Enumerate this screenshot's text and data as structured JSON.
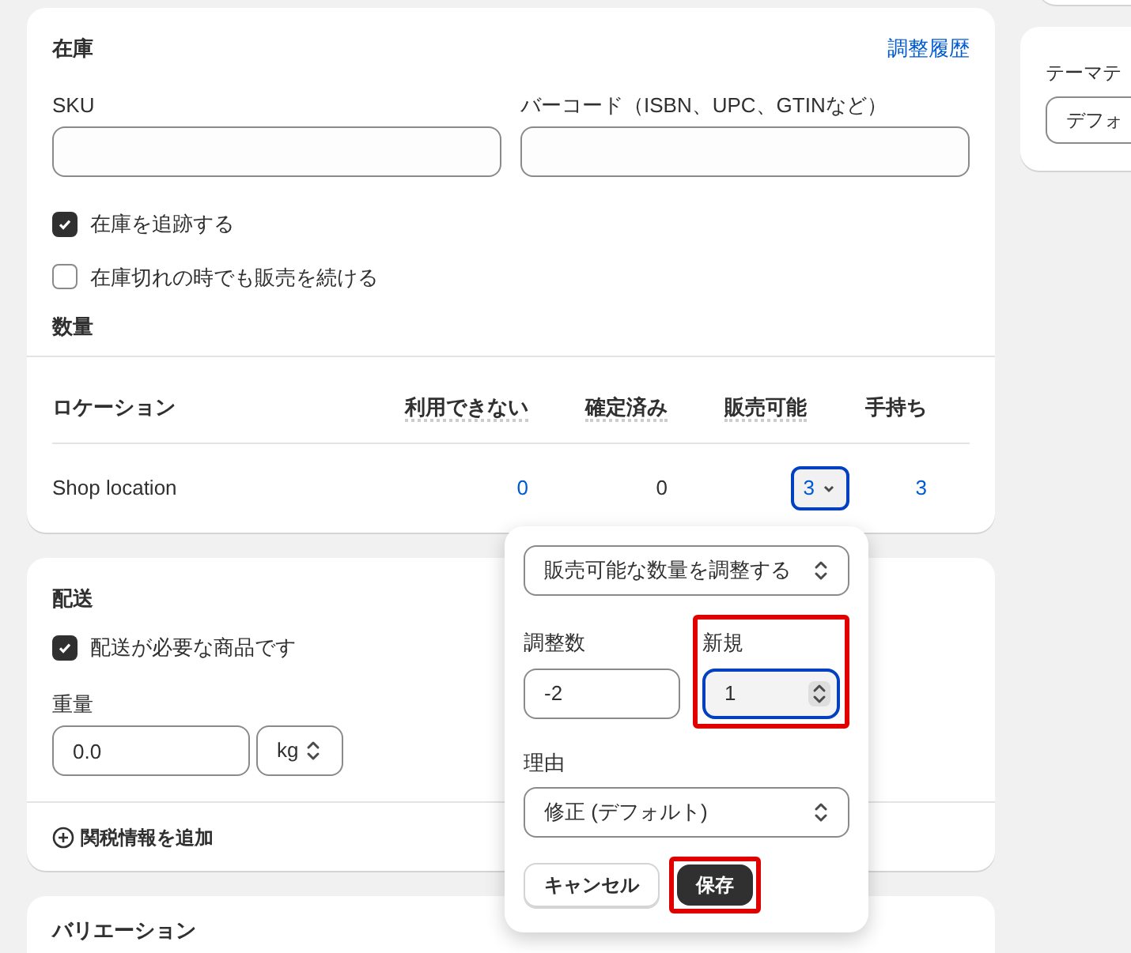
{
  "inventory": {
    "title": "在庫",
    "history_link": "調整履歴",
    "sku_label": "SKU",
    "barcode_label": "バーコード（ISBN、UPC、GTINなど）",
    "checkboxes": [
      {
        "label": "在庫を追跡する",
        "checked": true
      },
      {
        "label": "在庫切れの時でも販売を続ける",
        "checked": false
      }
    ],
    "quantity_title": "数量",
    "table": {
      "columns": [
        {
          "label": "ロケーション",
          "dotted": false
        },
        {
          "label": "利用できない",
          "dotted": true
        },
        {
          "label": "確定済み",
          "dotted": true
        },
        {
          "label": "販売可能",
          "dotted": true
        },
        {
          "label": "手持ち",
          "dotted": false
        }
      ],
      "rows": [
        {
          "cells": [
            {
              "kind": "location",
              "text": "Shop location"
            },
            {
              "kind": "link",
              "text": "0"
            },
            {
              "kind": "text",
              "text": "0"
            },
            {
              "kind": "dropdown",
              "text": "3",
              "expanded": true
            },
            {
              "kind": "link",
              "text": "3"
            }
          ]
        }
      ]
    }
  },
  "popover": {
    "adjust_select": "販売可能な数量を調整する",
    "adjust_label": "調整数",
    "adjust_value": "-2",
    "new_label": "新規",
    "new_value": "1",
    "new_highlighted": true,
    "reason_label": "理由",
    "reason_value": "修正 (デフォルト)",
    "cancel": "キャンセル",
    "save": "保存",
    "save_highlighted": true
  },
  "shipping": {
    "title": "配送",
    "checkbox": {
      "label": "配送が必要な商品です",
      "checked": true
    },
    "weight_label": "重量",
    "weight_value": "0.0",
    "unit": "kg",
    "customs_link": "関税情報を追加"
  },
  "variations": {
    "title": "バリエーション"
  },
  "side": {
    "label": "テーマテ",
    "select": "デフォ"
  }
}
